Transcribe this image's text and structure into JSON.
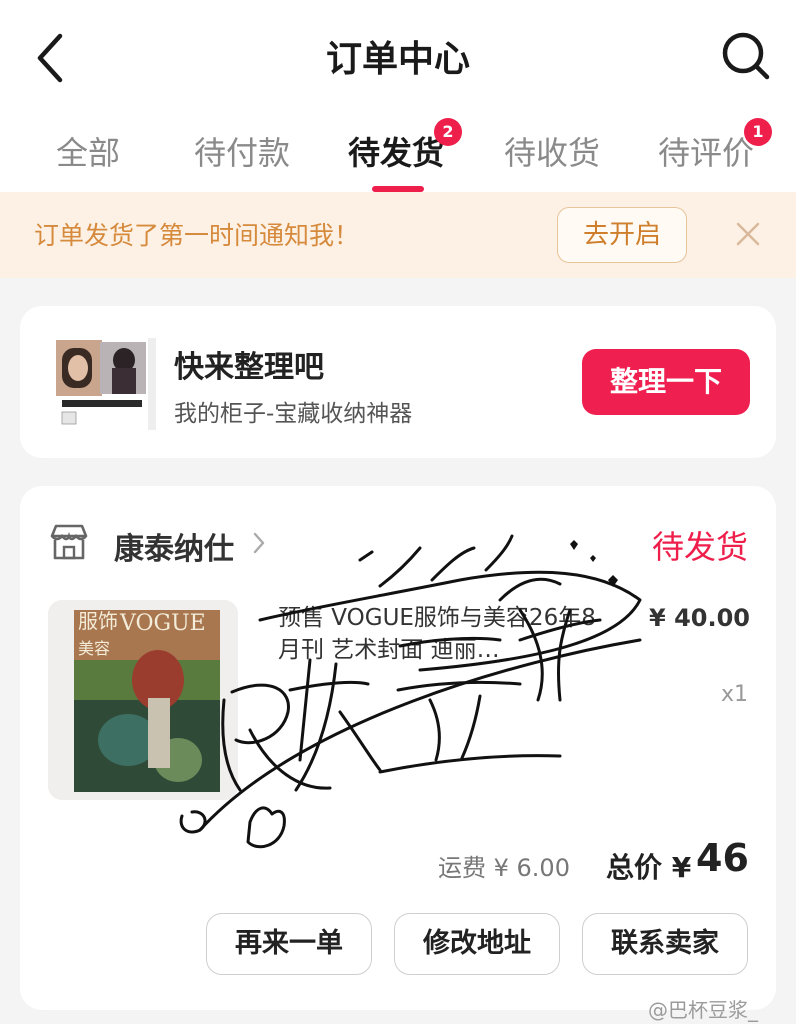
{
  "header": {
    "title": "订单中心"
  },
  "tabs": [
    {
      "label": "全部"
    },
    {
      "label": "待付款"
    },
    {
      "label": "待发货",
      "badge": "2",
      "active": true
    },
    {
      "label": "待收货"
    },
    {
      "label": "待评价",
      "badge": "1"
    }
  ],
  "notice": {
    "text": "订单发货了第一时间通知我！",
    "button": "去开启"
  },
  "promo": {
    "title": "快来整理吧",
    "subtitle": "我的柜子-宝藏收纳神器",
    "button": "整理一下"
  },
  "order": {
    "shop_name": "康泰纳仕",
    "status": "待发货",
    "product_title": "预售 VOGUE服饰与美容26年8月刊 艺术封面 迪丽…",
    "price": "¥ 40.00",
    "quantity": "x1",
    "cover_text_1": "服饰",
    "cover_text_2": "VOGUE",
    "cover_text_3": "美容",
    "shipping": "运费 ¥ 6.00",
    "total_label": "总价 ¥",
    "total_value": "46",
    "actions": [
      "再来一单",
      "修改地址",
      "联系卖家"
    ]
  },
  "watermark": {
    "signature": "巴杯豆浆",
    "signature_latin": "pamyi",
    "weibo": "@巴杯豆浆_"
  },
  "colors": {
    "accent": "#ee1f4b",
    "notice_bg": "#fdf1e6",
    "notice_text": "#d68a3c"
  },
  "icons": {
    "back": "chevron-left-icon",
    "search": "search-icon",
    "close": "close-icon",
    "shop": "store-icon",
    "shop_chevron": "chevron-right-icon"
  }
}
